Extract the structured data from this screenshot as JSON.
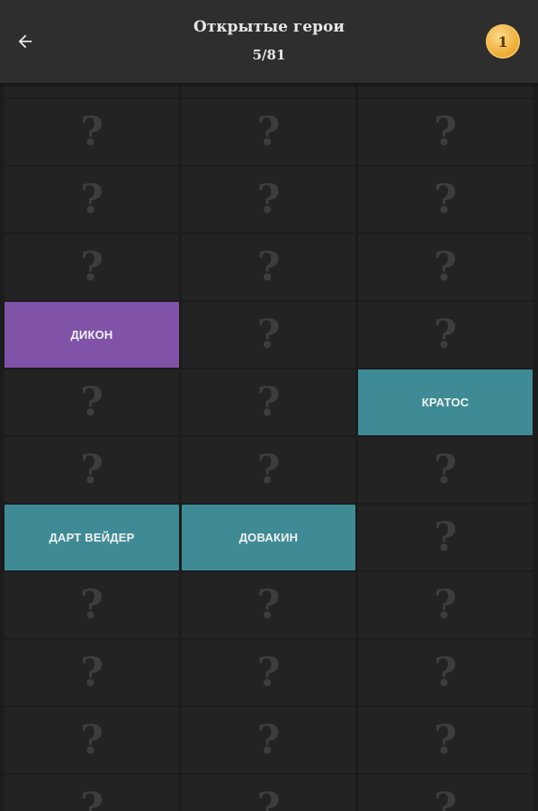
{
  "header": {
    "title": "Открытые герои",
    "counter": "5/81",
    "coins": "1"
  },
  "colors": {
    "purple": "#8053a8",
    "teal": "#3e8b95",
    "locked": "#232323"
  },
  "grid": {
    "locked_symbol": "?",
    "cells": [
      {
        "state": "locked"
      },
      {
        "state": "locked"
      },
      {
        "state": "locked"
      },
      {
        "state": "locked"
      },
      {
        "state": "locked"
      },
      {
        "state": "locked"
      },
      {
        "state": "locked"
      },
      {
        "state": "locked"
      },
      {
        "state": "locked"
      },
      {
        "state": "locked"
      },
      {
        "state": "locked"
      },
      {
        "state": "locked"
      },
      {
        "state": "open",
        "name": "ДИКОН",
        "color": "purple"
      },
      {
        "state": "locked"
      },
      {
        "state": "locked"
      },
      {
        "state": "locked"
      },
      {
        "state": "locked"
      },
      {
        "state": "open",
        "name": "КРАТОС",
        "color": "teal"
      },
      {
        "state": "locked"
      },
      {
        "state": "locked"
      },
      {
        "state": "locked"
      },
      {
        "state": "open",
        "name": "ДАРТ ВЕЙДЕР",
        "color": "teal"
      },
      {
        "state": "open",
        "name": "ДОВАКИН",
        "color": "teal"
      },
      {
        "state": "locked"
      },
      {
        "state": "locked"
      },
      {
        "state": "locked"
      },
      {
        "state": "locked"
      },
      {
        "state": "locked"
      },
      {
        "state": "locked"
      },
      {
        "state": "locked"
      },
      {
        "state": "locked"
      },
      {
        "state": "locked"
      },
      {
        "state": "locked"
      },
      {
        "state": "locked"
      },
      {
        "state": "locked"
      },
      {
        "state": "locked"
      }
    ]
  }
}
